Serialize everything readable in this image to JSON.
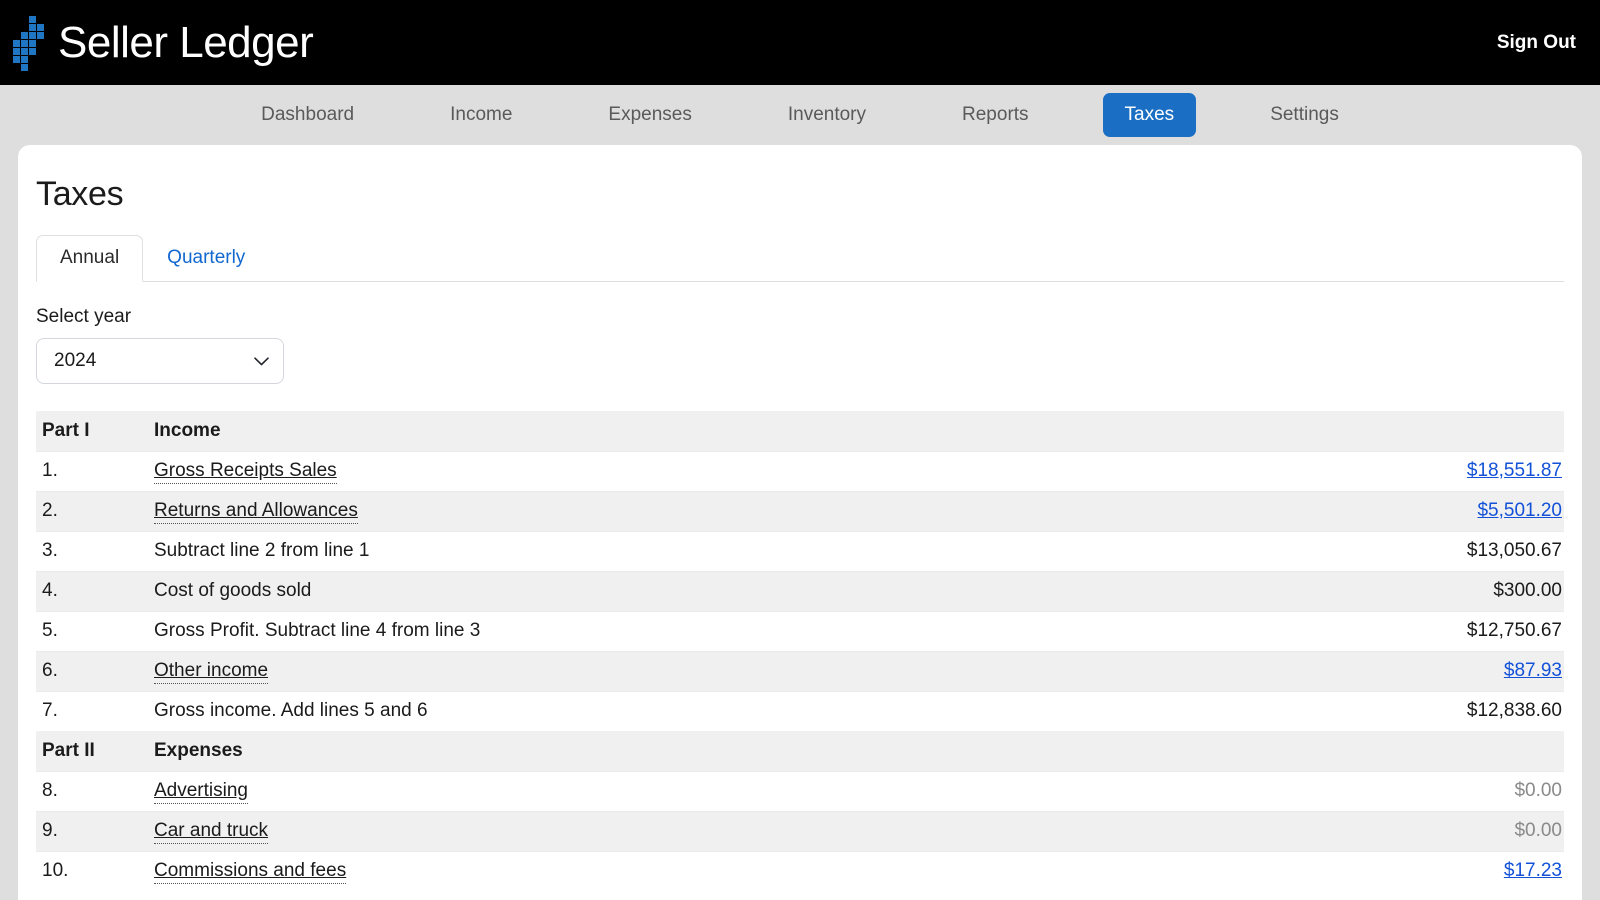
{
  "header": {
    "brand": "Seller Ledger",
    "logo_icon": "pixel-arrow-logo",
    "logo_color": "#1f77c4",
    "signout_label": "Sign Out"
  },
  "nav": {
    "active_accent": "#1a6fc4",
    "items": [
      {
        "label": "Dashboard",
        "active": false
      },
      {
        "label": "Income",
        "active": false
      },
      {
        "label": "Expenses",
        "active": false
      },
      {
        "label": "Inventory",
        "active": false
      },
      {
        "label": "Reports",
        "active": false
      },
      {
        "label": "Taxes",
        "active": true
      },
      {
        "label": "Settings",
        "active": false
      }
    ]
  },
  "page": {
    "title": "Taxes",
    "tabs": [
      {
        "label": "Annual",
        "active": true
      },
      {
        "label": "Quarterly",
        "active": false
      }
    ],
    "year_select": {
      "label": "Select year",
      "value": "2024",
      "chevron_icon": "chevron-down-icon"
    }
  },
  "table": {
    "sections": [
      {
        "part": "Part I",
        "heading": "Income",
        "rows": [
          {
            "num": "1.",
            "desc": "Gross Receipts Sales",
            "desc_link": true,
            "amount": "$18,551.87",
            "amount_link": true,
            "zero": false
          },
          {
            "num": "2.",
            "desc": "Returns and Allowances",
            "desc_link": true,
            "amount": "$5,501.20",
            "amount_link": true,
            "zero": false
          },
          {
            "num": "3.",
            "desc": "Subtract line 2 from line 1",
            "desc_link": false,
            "amount": "$13,050.67",
            "amount_link": false,
            "zero": false
          },
          {
            "num": "4.",
            "desc": "Cost of goods sold",
            "desc_link": false,
            "amount": "$300.00",
            "amount_link": false,
            "zero": false
          },
          {
            "num": "5.",
            "desc": "Gross Profit. Subtract line 4 from line 3",
            "desc_link": false,
            "amount": "$12,750.67",
            "amount_link": false,
            "zero": false
          },
          {
            "num": "6.",
            "desc": "Other income",
            "desc_link": true,
            "amount": "$87.93",
            "amount_link": true,
            "zero": false
          },
          {
            "num": "7.",
            "desc": "Gross income. Add lines 5 and 6",
            "desc_link": false,
            "amount": "$12,838.60",
            "amount_link": false,
            "zero": false
          }
        ]
      },
      {
        "part": "Part II",
        "heading": "Expenses",
        "rows": [
          {
            "num": "8.",
            "desc": "Advertising",
            "desc_link": true,
            "amount": "$0.00",
            "amount_link": false,
            "zero": true
          },
          {
            "num": "9.",
            "desc": "Car and truck",
            "desc_link": true,
            "amount": "$0.00",
            "amount_link": false,
            "zero": true
          },
          {
            "num": "10.",
            "desc": "Commissions and fees",
            "desc_link": true,
            "amount": "$17.23",
            "amount_link": true,
            "zero": false
          }
        ]
      }
    ]
  }
}
